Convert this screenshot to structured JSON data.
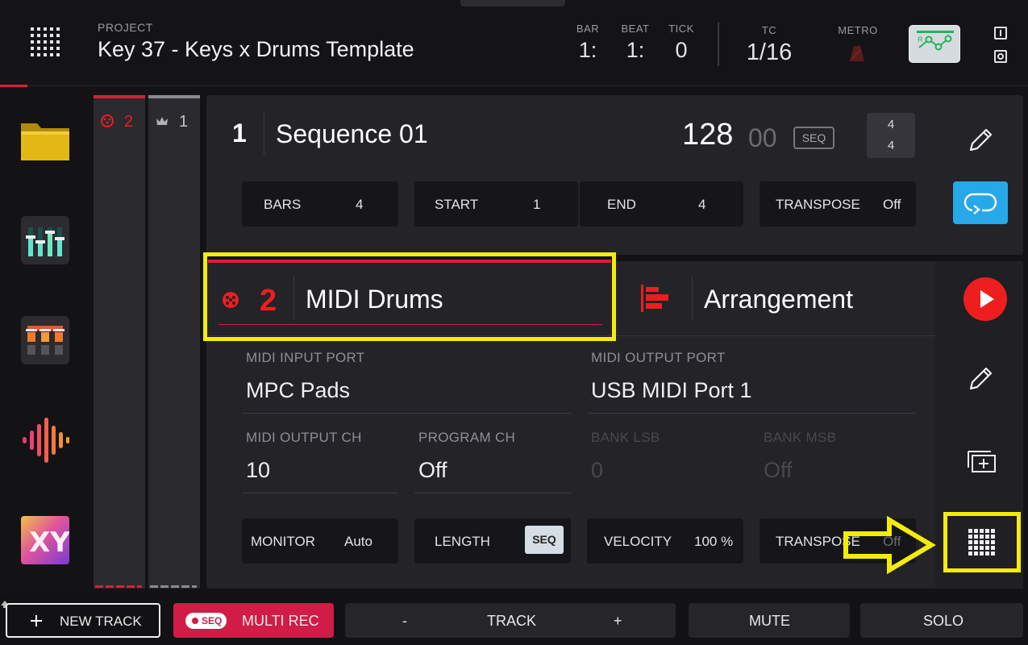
{
  "header": {
    "project_label": "PROJECT",
    "project_name": "Key 37 - Keys x Drums Template",
    "bar_label": "BAR",
    "bar_value": "1:",
    "beat_label": "BEAT",
    "beat_value": "1:",
    "tick_label": "TICK",
    "tick_value": "0",
    "tc_label": "TC",
    "tc_value": "1/16",
    "metro_label": "METRO"
  },
  "sidebar": {
    "items": [
      "folder-icon",
      "mixer-icon",
      "channel-mixer-icon",
      "sample-edit-icon",
      "xy-fx-icon"
    ]
  },
  "tracks_column": {
    "track_a_number": "2",
    "track_b_number": "1"
  },
  "sequence": {
    "number": "1",
    "name": "Sequence 01",
    "bpm": "128",
    "bpm_fraction": "00",
    "seq_badge": "SEQ",
    "timesig_top": "4",
    "timesig_bottom": "4",
    "bars_label": "BARS",
    "bars_value": "4",
    "start_label": "START",
    "start_value": "1",
    "end_label": "END",
    "end_value": "4",
    "transpose_label": "TRANSPOSE",
    "transpose_value": "Off"
  },
  "track": {
    "number": "2",
    "name": "MIDI Drums",
    "arrangement_label": "Arrangement",
    "midi_input_port_label": "MIDI INPUT PORT",
    "midi_input_port_value": "MPC Pads",
    "midi_output_port_label": "MIDI OUTPUT PORT",
    "midi_output_port_value": "USB MIDI Port 1",
    "midi_output_ch_label": "MIDI OUTPUT CH",
    "midi_output_ch_value": "10",
    "program_ch_label": "PROGRAM CH",
    "program_ch_value": "Off",
    "bank_lsb_label": "BANK LSB",
    "bank_lsb_value": "0",
    "bank_msb_label": "BANK MSB",
    "bank_msb_value": "Off",
    "monitor_label": "MONITOR",
    "monitor_value": "Auto",
    "length_label": "LENGTH",
    "length_value": "SEQ",
    "velocity_label": "VELOCITY",
    "velocity_value": "100 %",
    "transpose_label": "TRANSPOSE",
    "transpose_value": "Off"
  },
  "bottom": {
    "new_track": "NEW TRACK",
    "seq_chip": "SEQ",
    "multi_rec": "MULTI REC",
    "track_minus": "-",
    "track_label": "TRACK",
    "track_plus": "+",
    "mute": "MUTE",
    "solo": "SOLO"
  },
  "colors": {
    "accent_red": "#ee1e1e",
    "accent_blue": "#27a8e8",
    "annotation_yellow": "#f4ec07"
  }
}
